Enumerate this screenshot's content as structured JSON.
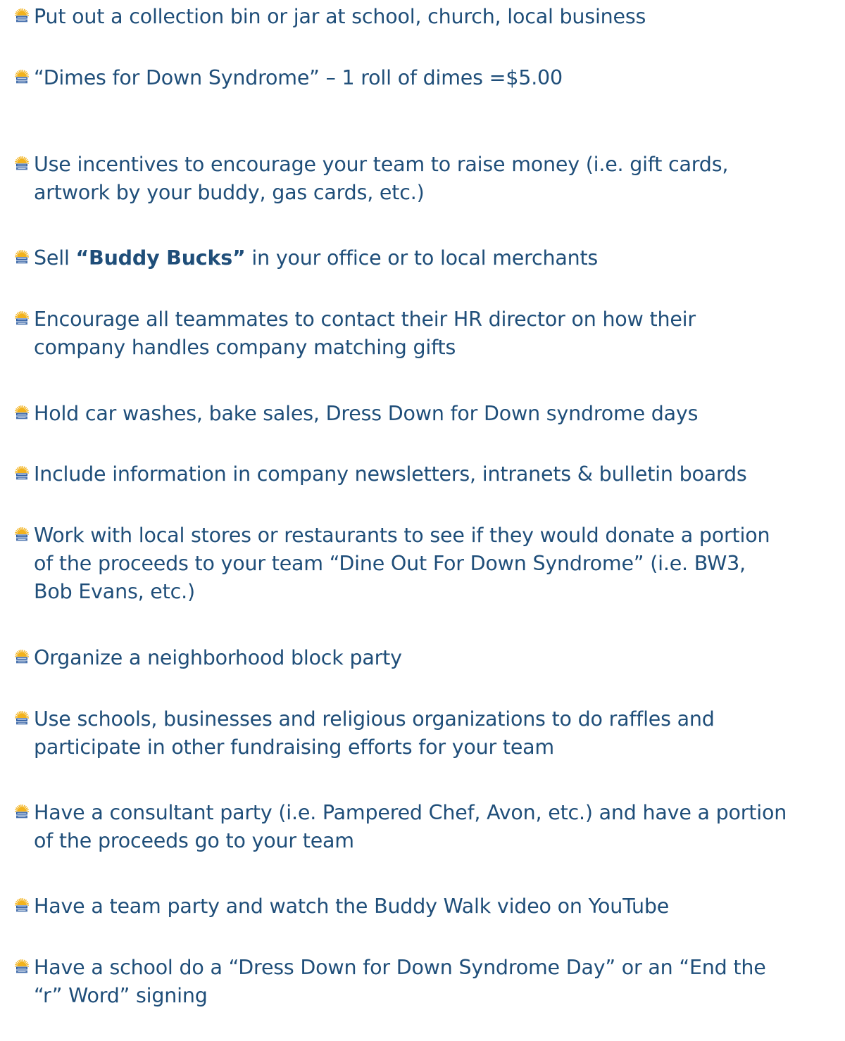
{
  "tips": [
    {
      "lines": [
        "Put out a collection bin or jar at school, church, local business"
      ]
    },
    {
      "lines": [
        "“Dimes for Down Syndrome” – 1 roll of dimes =$5.00"
      ]
    },
    {
      "lines": [
        "Use incentives to encourage your team to raise money (i.e. gift cards,",
        "artwork by your buddy, gas cards, etc.)"
      ]
    },
    {
      "before": "Sell ",
      "bold": "“Buddy Bucks”",
      "after": " in your office or to local merchants"
    },
    {
      "lines": [
        "Encourage all teammates to contact their HR director on how their",
        "company handles company matching gifts"
      ]
    },
    {
      "lines": [
        "Hold car washes, bake sales, Dress Down for Down syndrome days"
      ]
    },
    {
      "lines": [
        "Include information in company newsletters, intranets & bulletin boards"
      ]
    },
    {
      "lines": [
        "Work with local stores or restaurants to see if they would donate a portion",
        "of the proceeds to your team “Dine Out For Down Syndrome” (i.e. BW3,",
        "Bob Evans, etc.)"
      ]
    },
    {
      "lines": [
        "Organize a neighborhood block party"
      ]
    },
    {
      "lines": [
        "Use schools, businesses and religious organizations to do raffles and",
        "participate in other fundraising efforts for your team"
      ]
    },
    {
      "lines": [
        "Have a consultant party (i.e. Pampered Chef, Avon, etc.) and have a portion",
        "of the proceeds go to your team"
      ]
    },
    {
      "lines": [
        "Have a team party and watch the Buddy Walk video on YouTube"
      ]
    },
    {
      "lines": [
        "Have a school do a “Dress Down for Down Syndrome Day” or an “End the",
        "“r” Word” signing"
      ]
    }
  ],
  "bullet_icon": "buddy-walk-logo-icon",
  "colors": {
    "text": "#1f4e79",
    "logo_sun": "#f2b21c",
    "logo_text": "#2a5aa0"
  }
}
